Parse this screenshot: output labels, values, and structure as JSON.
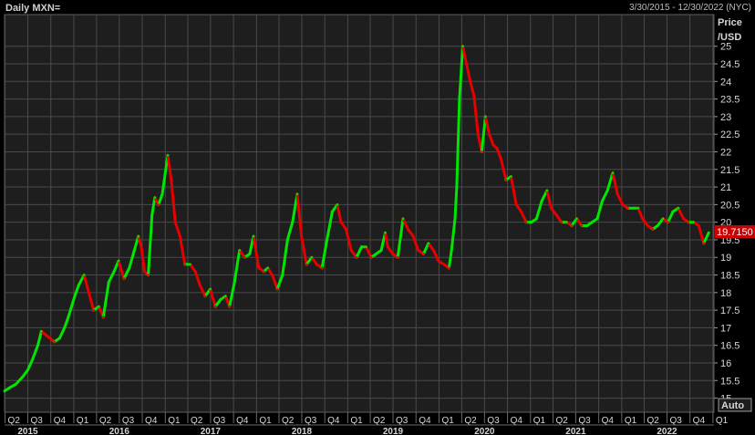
{
  "header": {
    "title": "Daily MXN=",
    "date_range": "3/30/2015 - 12/30/2022 (NYC)"
  },
  "axis": {
    "price_label_1": "Price",
    "price_label_2": "/USD",
    "auto_label": "Auto",
    "current_price": "19.7150"
  },
  "colors": {
    "background": "#000000",
    "plot_bg": "#1e1e1e",
    "grid": "#4a4a4a",
    "up": "#00e600",
    "down": "#e60000",
    "price_tag": "#cc0000"
  },
  "chart_data": {
    "type": "line",
    "title": "Daily MXN=",
    "ylabel": "Price /USD",
    "ylim": [
      14.6,
      25.9
    ],
    "y_ticks": [
      15,
      15.5,
      16,
      16.5,
      17,
      17.5,
      18,
      18.5,
      19,
      19.5,
      20,
      20.5,
      21,
      21.5,
      22,
      22.5,
      23,
      23.5,
      24,
      24.5,
      25
    ],
    "x_range": [
      "2015-03-30",
      "2022-12-30"
    ],
    "quarter_ticks": [
      "Q2",
      "Q3",
      "Q4",
      "Q1",
      "Q2",
      "Q3",
      "Q4",
      "Q1",
      "Q2",
      "Q3",
      "Q4",
      "Q1",
      "Q2",
      "Q3",
      "Q4",
      "Q1",
      "Q2",
      "Q3",
      "Q4",
      "Q1",
      "Q2",
      "Q3",
      "Q4",
      "Q1",
      "Q2",
      "Q3",
      "Q4",
      "Q1",
      "Q2",
      "Q3",
      "Q4",
      "Q1"
    ],
    "quarter_dates": [
      "2015-04-01",
      "2015-07-01",
      "2015-10-01",
      "2016-01-01",
      "2016-04-01",
      "2016-07-01",
      "2016-10-01",
      "2017-01-01",
      "2017-04-01",
      "2017-07-01",
      "2017-10-01",
      "2018-01-01",
      "2018-04-01",
      "2018-07-01",
      "2018-10-01",
      "2019-01-01",
      "2019-04-01",
      "2019-07-01",
      "2019-10-01",
      "2020-01-01",
      "2020-04-01",
      "2020-07-01",
      "2020-10-01",
      "2021-01-01",
      "2021-04-01",
      "2021-07-01",
      "2021-10-01",
      "2022-01-01",
      "2022-04-01",
      "2022-07-01",
      "2022-10-01",
      "2023-01-01"
    ],
    "year_labels": [
      "2015",
      "2016",
      "2017",
      "2018",
      "2019",
      "2020",
      "2021",
      "2022"
    ],
    "year_dates": [
      "2015-07-01",
      "2016-07-01",
      "2017-07-01",
      "2018-07-01",
      "2019-07-01",
      "2020-07-01",
      "2021-07-01",
      "2022-07-01"
    ],
    "series": [
      {
        "dates": [
          "2015-03-30",
          "2015-04-20",
          "2015-05-15",
          "2015-06-10",
          "2015-07-01",
          "2015-07-20",
          "2015-08-10",
          "2015-08-24",
          "2015-09-10",
          "2015-09-28",
          "2015-10-15",
          "2015-11-05",
          "2015-11-25",
          "2015-12-10",
          "2016-01-05",
          "2016-01-20",
          "2016-02-11",
          "2016-03-01",
          "2016-03-20",
          "2016-04-10",
          "2016-04-28",
          "2016-05-20",
          "2016-06-10",
          "2016-06-28",
          "2016-07-20",
          "2016-08-10",
          "2016-08-30",
          "2016-09-15",
          "2016-09-27",
          "2016-10-10",
          "2016-10-25",
          "2016-11-09",
          "2016-11-20",
          "2016-12-05",
          "2016-12-20",
          "2017-01-11",
          "2017-01-25",
          "2017-02-10",
          "2017-03-01",
          "2017-03-20",
          "2017-04-10",
          "2017-05-01",
          "2017-05-20",
          "2017-06-10",
          "2017-06-30",
          "2017-07-20",
          "2017-08-10",
          "2017-08-30",
          "2017-09-15",
          "2017-10-05",
          "2017-10-25",
          "2017-11-15",
          "2017-12-05",
          "2017-12-20",
          "2018-01-10",
          "2018-01-30",
          "2018-02-15",
          "2018-03-05",
          "2018-03-25",
          "2018-04-15",
          "2018-05-05",
          "2018-05-25",
          "2018-06-13",
          "2018-06-30",
          "2018-07-20",
          "2018-08-10",
          "2018-08-30",
          "2018-09-20",
          "2018-10-10",
          "2018-10-31",
          "2018-11-20",
          "2018-12-05",
          "2018-12-25",
          "2019-01-15",
          "2019-02-05",
          "2019-02-25",
          "2019-03-15",
          "2019-04-05",
          "2019-04-25",
          "2019-05-15",
          "2019-05-31",
          "2019-06-10",
          "2019-06-30",
          "2019-07-20",
          "2019-08-10",
          "2019-08-30",
          "2019-09-20",
          "2019-10-10",
          "2019-10-31",
          "2019-11-20",
          "2019-12-10",
          "2019-12-30",
          "2020-01-20",
          "2020-02-10",
          "2020-02-20",
          "2020-03-05",
          "2020-03-12",
          "2020-03-23",
          "2020-04-05",
          "2020-04-20",
          "2020-05-05",
          "2020-05-20",
          "2020-06-05",
          "2020-06-20",
          "2020-07-05",
          "2020-07-20",
          "2020-08-05",
          "2020-08-20",
          "2020-09-05",
          "2020-09-25",
          "2020-10-15",
          "2020-11-05",
          "2020-11-25",
          "2020-12-15",
          "2021-01-05",
          "2021-01-25",
          "2021-02-15",
          "2021-03-08",
          "2021-03-25",
          "2021-04-15",
          "2021-05-05",
          "2021-05-25",
          "2021-06-15",
          "2021-07-05",
          "2021-07-25",
          "2021-08-15",
          "2021-09-05",
          "2021-09-25",
          "2021-10-15",
          "2021-11-05",
          "2021-11-26",
          "2021-12-15",
          "2022-01-05",
          "2022-01-25",
          "2022-02-15",
          "2022-03-08",
          "2022-03-25",
          "2022-04-15",
          "2022-05-05",
          "2022-05-25",
          "2022-06-15",
          "2022-07-05",
          "2022-07-25",
          "2022-08-15",
          "2022-09-05",
          "2022-09-25",
          "2022-10-15",
          "2022-11-05",
          "2022-11-25",
          "2022-12-15",
          "2022-12-30"
        ],
        "values": [
          15.2,
          15.3,
          15.4,
          15.6,
          15.8,
          16.1,
          16.5,
          16.9,
          16.8,
          16.7,
          16.6,
          16.7,
          17.0,
          17.3,
          17.9,
          18.2,
          18.5,
          18.0,
          17.5,
          17.6,
          17.3,
          18.3,
          18.6,
          18.9,
          18.4,
          18.7,
          19.2,
          19.6,
          19.3,
          18.6,
          18.5,
          20.2,
          20.7,
          20.5,
          20.8,
          21.9,
          21.2,
          20.0,
          19.6,
          18.8,
          18.8,
          18.6,
          18.2,
          17.9,
          18.1,
          17.6,
          17.8,
          17.9,
          17.6,
          18.3,
          19.2,
          19.0,
          19.1,
          19.6,
          18.7,
          18.6,
          18.7,
          18.5,
          18.1,
          18.5,
          19.5,
          20.0,
          20.8,
          19.6,
          18.8,
          19.0,
          18.8,
          18.7,
          19.5,
          20.3,
          20.5,
          20.0,
          19.8,
          19.2,
          19.0,
          19.3,
          19.3,
          19.0,
          19.1,
          19.2,
          19.7,
          19.3,
          19.1,
          19.0,
          20.1,
          19.8,
          19.6,
          19.2,
          19.1,
          19.4,
          19.2,
          18.9,
          18.8,
          18.7,
          19.2,
          20.1,
          21.0,
          23.5,
          25.0,
          24.5,
          24.0,
          23.6,
          22.5,
          22.0,
          23.0,
          22.5,
          22.2,
          22.1,
          21.8,
          21.2,
          21.3,
          20.5,
          20.3,
          20.0,
          20.0,
          20.1,
          20.6,
          20.9,
          20.4,
          20.2,
          20.0,
          20.0,
          19.9,
          20.1,
          19.9,
          19.9,
          20.0,
          20.1,
          20.6,
          20.9,
          21.4,
          20.8,
          20.5,
          20.4,
          20.4,
          20.4,
          20.1,
          19.9,
          19.8,
          19.9,
          20.1,
          20.0,
          20.3,
          20.4,
          20.1,
          20.0,
          20.0,
          19.9,
          19.4,
          19.7
        ]
      }
    ]
  }
}
